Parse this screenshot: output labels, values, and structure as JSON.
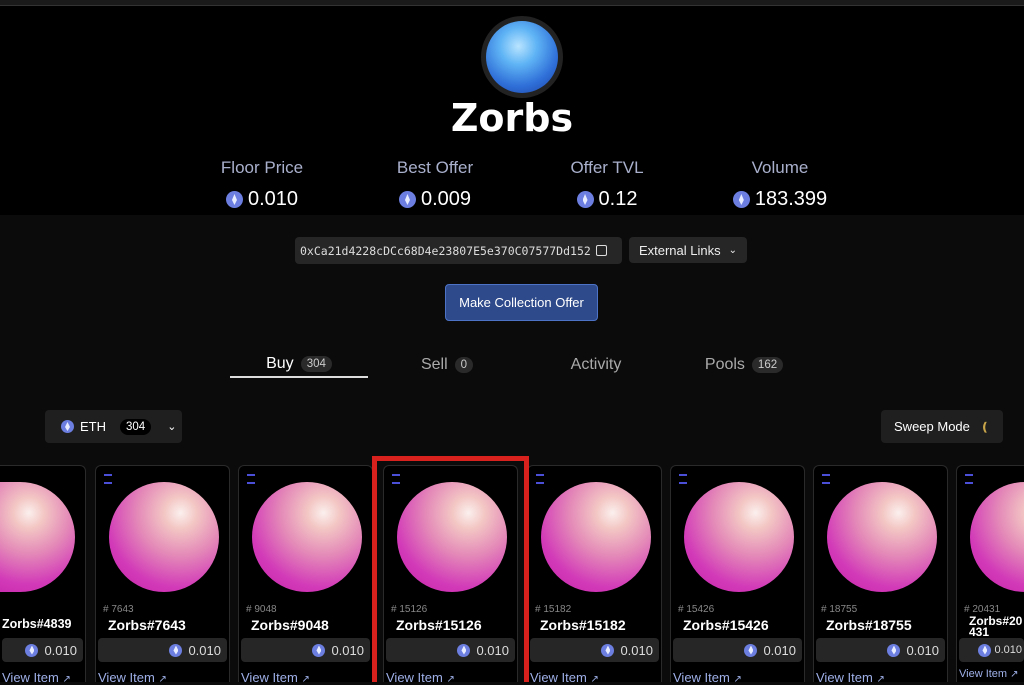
{
  "collection": {
    "name": "Zorbs"
  },
  "stats": [
    {
      "label": "Floor Price",
      "value": "0.010"
    },
    {
      "label": "Best Offer",
      "value": "0.009"
    },
    {
      "label": "Offer TVL",
      "value": "0.12"
    },
    {
      "label": "Volume",
      "value": "183.399"
    }
  ],
  "contract_address": "0xCa21d4228cDCc68D4e23807E5e370C07577Dd152",
  "external_links_label": "External Links",
  "make_offer_label": "Make Collection Offer",
  "tabs": [
    {
      "label": "Buy",
      "count": "304",
      "active": true
    },
    {
      "label": "Sell",
      "count": "0"
    },
    {
      "label": "Activity"
    },
    {
      "label": "Pools",
      "count": "162"
    }
  ],
  "chain_filter": {
    "label": "ETH",
    "count": "304"
  },
  "sweep_label": "Sweep Mode",
  "highlight_color": "#d8201d",
  "cards": [
    {
      "token_id": "",
      "name": "Zorbs#4839",
      "price": "0.010",
      "view": "View Item"
    },
    {
      "token_id": "# 7643",
      "name": "Zorbs#7643",
      "price": "0.010",
      "view": "View Item"
    },
    {
      "token_id": "# 9048",
      "name": "Zorbs#9048",
      "price": "0.010",
      "view": "View Item"
    },
    {
      "token_id": "# 15126",
      "name": "Zorbs#15126",
      "price": "0.010",
      "view": "View Item",
      "highlighted": true
    },
    {
      "token_id": "# 15182",
      "name": "Zorbs#15182",
      "price": "0.010",
      "view": "View Item"
    },
    {
      "token_id": "# 15426",
      "name": "Zorbs#15426",
      "price": "0.010",
      "view": "View Item"
    },
    {
      "token_id": "# 18755",
      "name": "Zorbs#18755",
      "price": "0.010",
      "view": "View Item"
    },
    {
      "token_id": "# 20431",
      "name": "Zorbs#20431",
      "price": "0.010",
      "view": "View Item"
    }
  ]
}
